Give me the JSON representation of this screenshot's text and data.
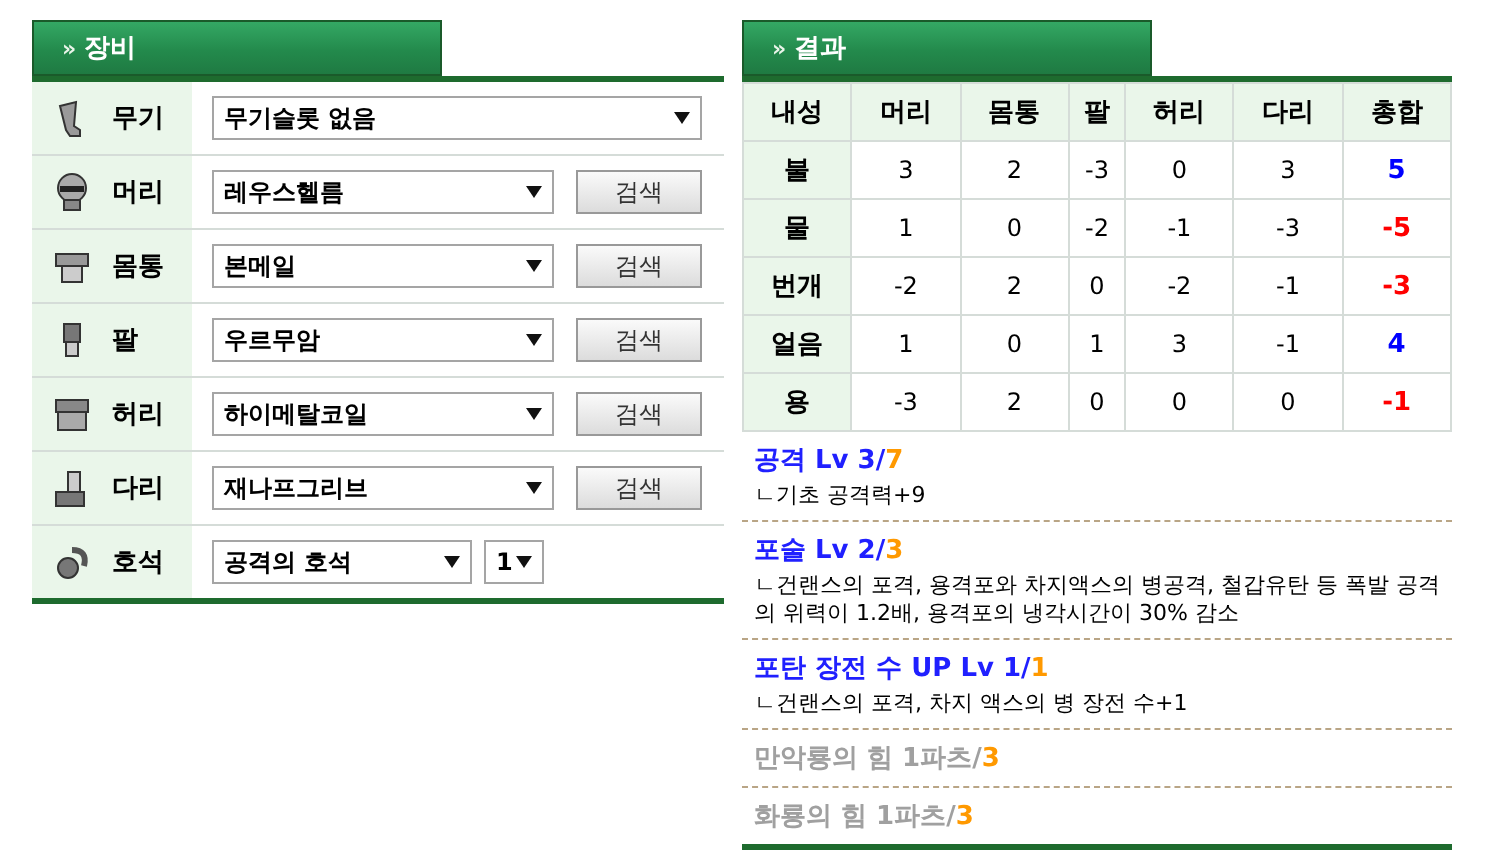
{
  "equipment": {
    "header": "장비",
    "arrows": "»",
    "rows": [
      {
        "kind": "weapon",
        "label": "무기",
        "value": "무기슬롯 없음"
      },
      {
        "kind": "helmet",
        "label": "머리",
        "value": "레우스헬름",
        "button": "검색"
      },
      {
        "kind": "armor",
        "label": "몸통",
        "value": "본메일",
        "button": "검색"
      },
      {
        "kind": "arm",
        "label": "팔",
        "value": "우르무암",
        "button": "검색"
      },
      {
        "kind": "waist",
        "label": "허리",
        "value": "하이메탈코일",
        "button": "검색"
      },
      {
        "kind": "leg",
        "label": "다리",
        "value": "재나프그리브",
        "button": "검색"
      },
      {
        "kind": "gem",
        "label": "호석",
        "value": "공격의 호석",
        "count": "1"
      }
    ]
  },
  "result": {
    "header": "결과",
    "arrows": "»",
    "columns": [
      "내성",
      "머리",
      "몸통",
      "팔",
      "허리",
      "다리",
      "총합"
    ],
    "rows": [
      {
        "name": "불",
        "values": [
          "3",
          "2",
          "-3",
          "0",
          "3"
        ],
        "total": "5",
        "color": "#0000ff"
      },
      {
        "name": "물",
        "values": [
          "1",
          "0",
          "-2",
          "-1",
          "-3"
        ],
        "total": "-5",
        "color": "#ff0000"
      },
      {
        "name": "번개",
        "values": [
          "-2",
          "2",
          "0",
          "-2",
          "-1"
        ],
        "total": "-3",
        "color": "#ff0000"
      },
      {
        "name": "얼음",
        "values": [
          "1",
          "0",
          "1",
          "3",
          "-1"
        ],
        "total": "4",
        "color": "#0000ff"
      },
      {
        "name": "용",
        "values": [
          "-3",
          "2",
          "0",
          "0",
          "0"
        ],
        "total": "-1",
        "color": "#ff0000"
      }
    ],
    "skills": [
      {
        "name": "공격 Lv 3/",
        "max": "7",
        "active": true,
        "description": "ㄴ기초 공격력+9"
      },
      {
        "name": "포술 Lv 2/",
        "max": "3",
        "active": true,
        "description": "ㄴ건랜스의 포격, 용격포와 차지액스의 병공격, 철갑유탄 등 폭발 공격의 위력이 1.2배, 용격포의 냉각시간이 30% 감소"
      },
      {
        "name": "포탄 장전 수 UP Lv 1/",
        "max": "1",
        "active": true,
        "description": "ㄴ건랜스의 포격, 차지 액스의 병 장전 수+1"
      },
      {
        "name": "만악룡의 힘 1파츠/",
        "max": "3",
        "active": false
      },
      {
        "name": "화룡의 힘 1파츠/",
        "max": "3",
        "active": false
      }
    ]
  }
}
